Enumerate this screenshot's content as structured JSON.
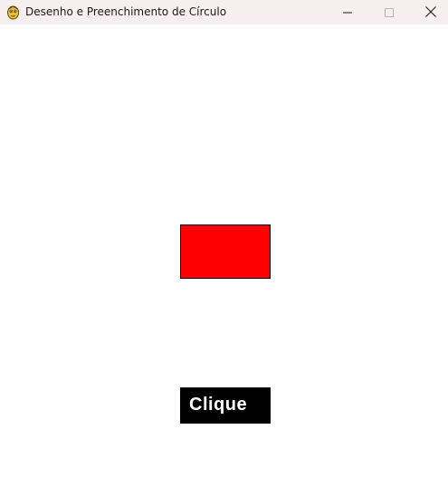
{
  "window": {
    "title": "Desenho e Preenchimento de Círculo",
    "icon": "pygame-snake-icon",
    "controls": {
      "minimize_icon": "minimize-icon",
      "maximize_icon": "maximize-icon",
      "close_icon": "close-icon"
    }
  },
  "canvas": {
    "background_color": "#ffffff",
    "shape": {
      "kind": "rectangle",
      "fill_color": "#ff0000",
      "border_color": "#000000"
    },
    "button": {
      "label": "Clique",
      "background_color": "#000000",
      "text_color": "#ffffff"
    }
  }
}
